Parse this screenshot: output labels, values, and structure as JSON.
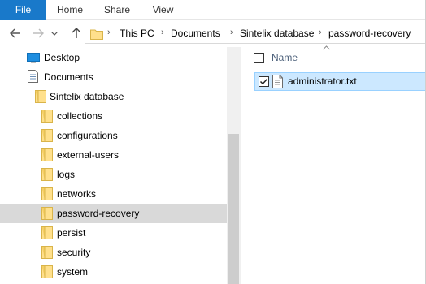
{
  "ribbon": {
    "tabs": [
      "File",
      "Home",
      "Share",
      "View"
    ]
  },
  "address": {
    "breadcrumbs": [
      "This PC",
      "Documents",
      "Sintelix database",
      "password-recovery"
    ]
  },
  "nav_tree": {
    "items": [
      {
        "label": "Desktop",
        "icon": "desktop-icon"
      },
      {
        "label": "Documents",
        "icon": "documents-icon"
      },
      {
        "label": "Sintelix database",
        "icon": "folder-icon"
      },
      {
        "label": "collections",
        "icon": "folder-icon"
      },
      {
        "label": "configurations",
        "icon": "folder-icon"
      },
      {
        "label": "external-users",
        "icon": "folder-icon"
      },
      {
        "label": "logs",
        "icon": "folder-icon"
      },
      {
        "label": "networks",
        "icon": "folder-icon"
      },
      {
        "label": "password-recovery",
        "icon": "folder-icon",
        "selected": true
      },
      {
        "label": "persist",
        "icon": "folder-icon"
      },
      {
        "label": "security",
        "icon": "folder-icon"
      },
      {
        "label": "system",
        "icon": "folder-icon"
      }
    ]
  },
  "content": {
    "column_header": "Name",
    "files": [
      {
        "name": "administrator.txt",
        "checked": true,
        "icon": "text-file-icon"
      }
    ]
  },
  "colors": {
    "file_tab_bg": "#1979ca",
    "selection_bg": "#cce8ff",
    "tree_selected_bg": "#d9d9d9",
    "folder_yellow": "#ffe08c"
  }
}
